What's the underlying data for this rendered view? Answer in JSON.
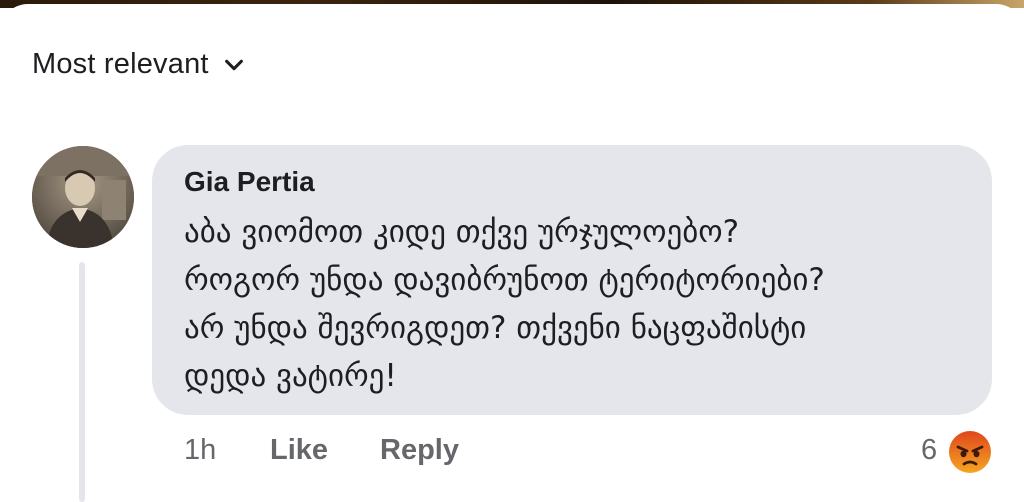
{
  "sort": {
    "label": "Most relevant",
    "icon": "chevron-down-icon"
  },
  "comment": {
    "author": "Gia Pertia",
    "text": "აბა  ვიომოთ კიდე თქვე ურჯულოებო?\nროგორ უნდა დავიბრუნოთ ტერიტორიები?\nარ უნდა შევრიგდეთ? თქვენი ნაცფაშისტი\nდედა ვატირე!",
    "time": "1h",
    "like_label": "Like",
    "reply_label": "Reply",
    "reaction_count": "6",
    "reaction_icon": "angry-reaction-icon"
  },
  "colors": {
    "bubble": "#e4e6eb",
    "text": "#1c1e21",
    "meta": "#65676b",
    "angry": "#e9710f"
  }
}
